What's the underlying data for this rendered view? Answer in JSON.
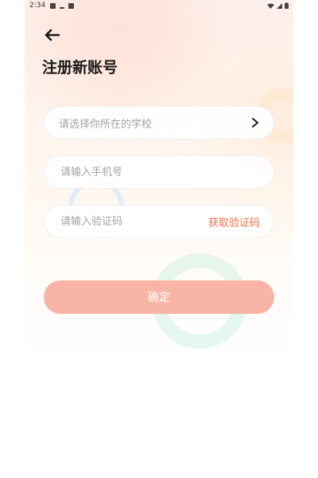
{
  "status_bar": {
    "time": "2:34"
  },
  "header": {
    "title": "注册新账号"
  },
  "form": {
    "school_placeholder": "请选择你所在的学校",
    "phone_placeholder": "请输入手机号",
    "code_placeholder": "请输入验证码",
    "get_code_label": "获取验证码",
    "confirm_label": "确定"
  },
  "colors": {
    "accent": "#f0704f",
    "button": "#f8b5a5"
  }
}
